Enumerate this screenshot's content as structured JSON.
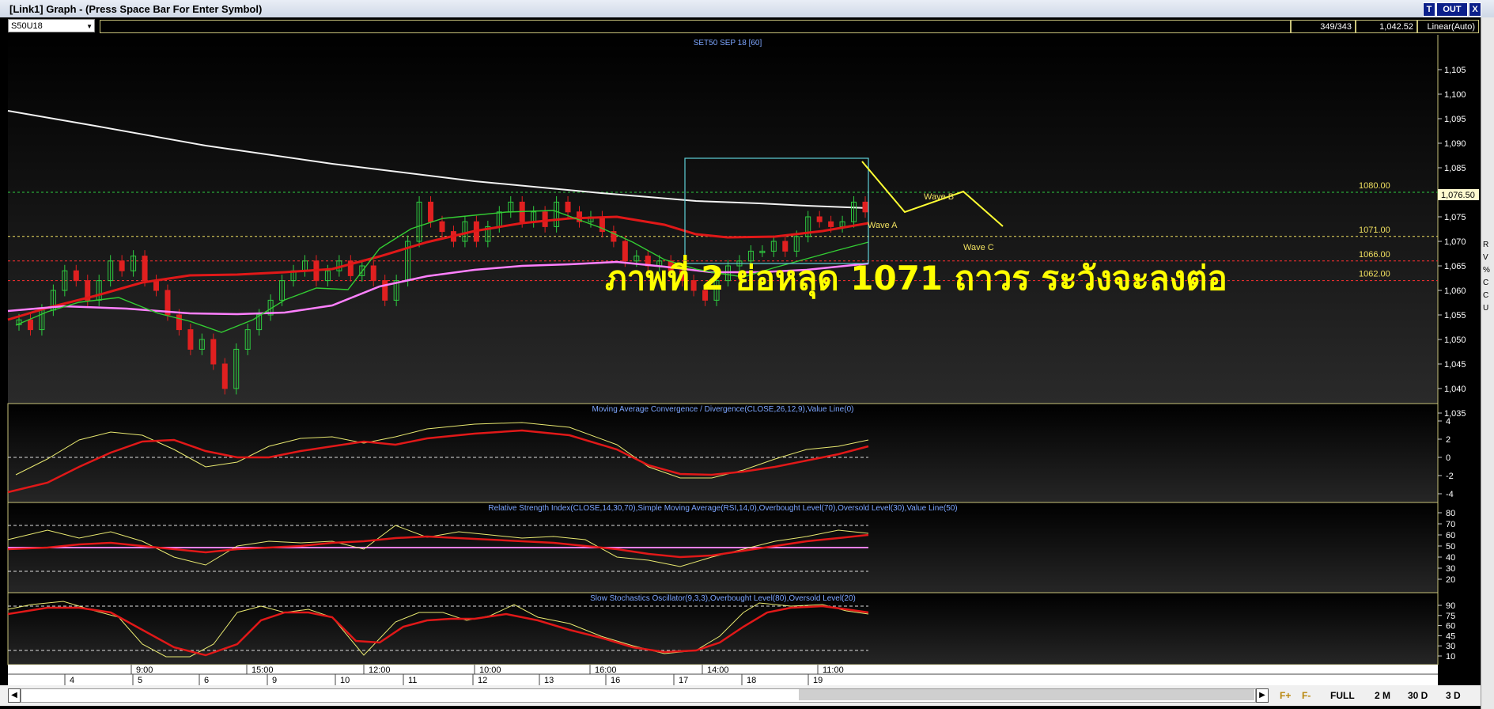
{
  "window": {
    "title": "[Link1] Graph  - (Press Space Bar For Enter Symbol)",
    "buttons": {
      "t": "T",
      "out": "OUT",
      "x": "X"
    }
  },
  "toolbar": {
    "symbol": "S50U18",
    "counter": "349/343",
    "price": "1,042.52",
    "scale": "Linear(Auto)"
  },
  "chart": {
    "title": "SET50 SEP 18   [60]",
    "price_axis": [
      "1,105",
      "1,100",
      "1,095",
      "1,090",
      "1,085",
      "1,080",
      "1,075",
      "1,070",
      "1,065",
      "1,060",
      "1,055",
      "1,050",
      "1,045",
      "1,040",
      "1,035"
    ],
    "last_price": "1,076.50",
    "levels": [
      {
        "label": "1080.00",
        "value": 1080,
        "color": "#2ecc40"
      },
      {
        "label": "1071.00",
        "value": 1071,
        "color": "#f0e060"
      },
      {
        "label": "1066.00",
        "value": 1066,
        "color": "#ff3030"
      },
      {
        "label": "1062.00",
        "value": 1062,
        "color": "#ff3030"
      }
    ],
    "waves": [
      "Wave A",
      "Wave B",
      "Wave C"
    ],
    "annotation": "ภาพที่ 2 ย่อหลุด 1071 ถาวร ระวังจะลงต่อ"
  },
  "indicators": {
    "macd": {
      "title": "Moving Average Convergence / Divergence(CLOSE,26,12,9),Value Line(0)",
      "axis": [
        "4",
        "2",
        "0",
        "-2",
        "-4"
      ]
    },
    "rsi": {
      "title": "Relative Strength Index(CLOSE,14,30,70),Simple Moving Average(RSI,14,0),Overbought Level(70),Oversold Level(30),Value Line(50)",
      "axis": [
        "80",
        "70",
        "60",
        "50",
        "40",
        "30",
        "20"
      ]
    },
    "stoch": {
      "title": "Slow Stochastics Oscillator(9,3,3),Overbought Level(80),Oversold Level(20)",
      "axis": [
        "90",
        "75",
        "60",
        "45",
        "30",
        "10"
      ]
    }
  },
  "time_axis": {
    "times": [
      "9:00",
      "15:00",
      "12:00",
      "10:00",
      "16:00",
      "14:00",
      "11:00"
    ],
    "days": [
      "4",
      "5",
      "6",
      "9",
      "10",
      "11",
      "12",
      "13",
      "16",
      "17",
      "18",
      "19"
    ]
  },
  "bottom": {
    "f_plus": "F+",
    "f_minus": "F-",
    "full": "FULL",
    "2m": "2 M",
    "30d": "30 D",
    "3d": "3 D"
  },
  "right_strip": [
    "R",
    "V",
    "%",
    "C",
    "C",
    "U"
  ],
  "colors": {
    "background": "#000000",
    "candle_up": "#2ecc40",
    "candle_down": "#e02020",
    "ema_slow": "#e01818",
    "ema_pink": "#ff80ff",
    "ema_fast": "#33cc33",
    "long_ma": "#ffffff",
    "wave": "#ffff33",
    "box": "#5fd0d8"
  }
}
